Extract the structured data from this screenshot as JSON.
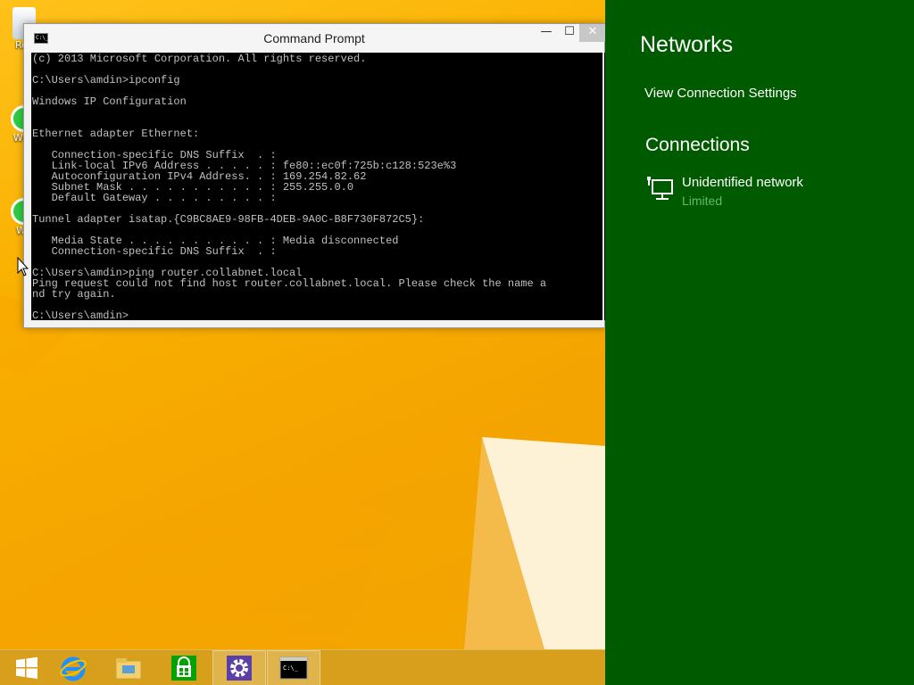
{
  "desktop": {
    "icons": [
      {
        "name": "recycle-bin",
        "label": "Rec"
      },
      {
        "name": "whatsapp-1",
        "label": "Wha"
      },
      {
        "name": "whatsapp-2",
        "label": "Wh"
      }
    ]
  },
  "cmd": {
    "title": "Command Prompt",
    "icon_text": "C:\\_",
    "minimize_glyph": "—",
    "maximize_glyph": "☐",
    "close_glyph": "✕",
    "output": "(c) 2013 Microsoft Corporation. All rights reserved.\n\nC:\\Users\\amdin>ipconfig\n\nWindows IP Configuration\n\n\nEthernet adapter Ethernet:\n\n   Connection-specific DNS Suffix  . :\n   Link-local IPv6 Address . . . . . : fe80::ec0f:725b:c128:523e%3\n   Autoconfiguration IPv4 Address. . : 169.254.82.62\n   Subnet Mask . . . . . . . . . . . : 255.255.0.0\n   Default Gateway . . . . . . . . . :\n\nTunnel adapter isatap.{C9BC8AE9-98FB-4DEB-9A0C-B8F730F872C5}:\n\n   Media State . . . . . . . . . . . : Media disconnected\n   Connection-specific DNS Suffix  . :\n\nC:\\Users\\amdin>ping router.collabnet.local\nPing request could not find host router.collabnet.local. Please check the name a\nnd try again.\n\nC:\\Users\\amdin>"
  },
  "networks": {
    "title": "Networks",
    "view_settings": "View Connection Settings",
    "connections_header": "Connections",
    "items": [
      {
        "name": "Unidentified network",
        "status": "Limited"
      }
    ]
  },
  "taskbar": {
    "items": [
      {
        "name": "start",
        "icon": "windows-logo-icon"
      },
      {
        "name": "internet-explorer",
        "icon": "ie-icon"
      },
      {
        "name": "file-explorer",
        "icon": "folder-icon"
      },
      {
        "name": "store",
        "icon": "store-icon"
      },
      {
        "name": "settings",
        "icon": "gear-icon",
        "active": true
      },
      {
        "name": "command-prompt",
        "icon": "cmd-icon",
        "active": true
      }
    ]
  },
  "colors": {
    "charm_bg": "#005a00",
    "limited_text": "#5fbe5f",
    "desktop_bg": "#f6b700"
  }
}
